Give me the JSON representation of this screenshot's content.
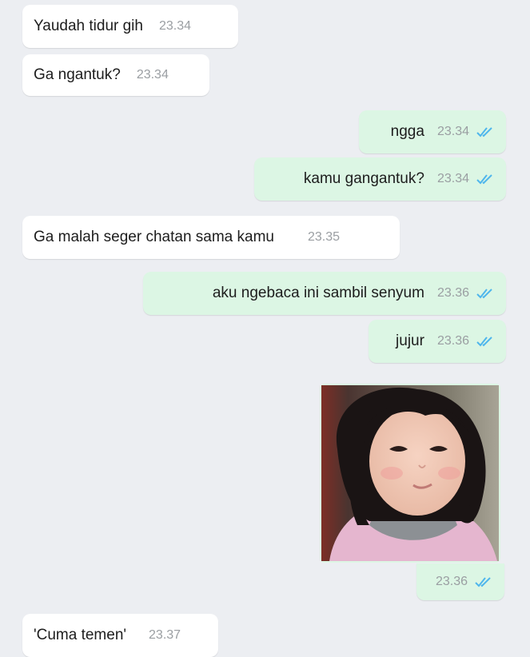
{
  "colors": {
    "background": "#eceef2",
    "incoming_bubble": "#ffffff",
    "outgoing_bubble": "#dcf6e4",
    "read_ticks": "#4fb6ec",
    "timestamp": "#9a9ea2"
  },
  "messages": [
    {
      "direction": "in",
      "text": "Yaudah tidur gih",
      "time": "23.34"
    },
    {
      "direction": "in",
      "text": "Ga ngantuk?",
      "time": "23.34"
    },
    {
      "direction": "out",
      "text": "ngga",
      "time": "23.34",
      "status": "read"
    },
    {
      "direction": "out",
      "text": "kamu gangantuk?",
      "time": "23.34",
      "status": "read"
    },
    {
      "direction": "in",
      "text": "Ga malah seger chatan sama kamu",
      "time": "23.35"
    },
    {
      "direction": "out",
      "text": "aku ngebaca ini sambil senyum",
      "time": "23.36",
      "status": "read"
    },
    {
      "direction": "out",
      "text": "jujur",
      "time": "23.36",
      "status": "read"
    },
    {
      "direction": "out",
      "type": "image",
      "image_icon": "smiling-child-photo",
      "time": "23.36",
      "status": "read"
    },
    {
      "direction": "in",
      "text": "'Cuma temen'",
      "time": "23.37"
    }
  ]
}
